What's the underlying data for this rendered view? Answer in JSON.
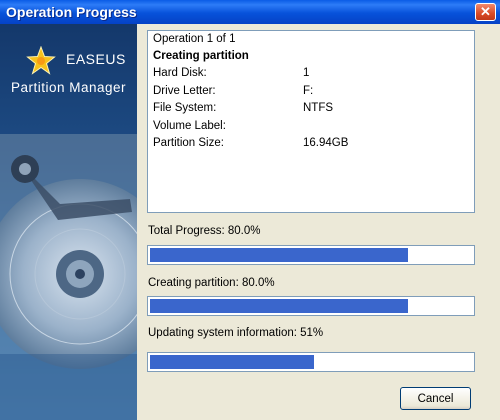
{
  "window": {
    "title": "Operation Progress",
    "close_glyph": "✕"
  },
  "sidebar": {
    "brand": "EASEUS",
    "product": "Partition Manager"
  },
  "info": {
    "operation": "Operation 1 of 1",
    "heading": "Creating partition",
    "rows": [
      {
        "label": "Hard Disk:",
        "value": "1"
      },
      {
        "label": "Drive Letter:",
        "value": "F:"
      },
      {
        "label": "File System:",
        "value": "NTFS"
      },
      {
        "label": "Volume Label:",
        "value": ""
      },
      {
        "label": "Partition Size:",
        "value": "16.94GB"
      }
    ]
  },
  "progress": [
    {
      "label": "Total Progress: 80.0%",
      "percent": 80
    },
    {
      "label": "Creating partition: 80.0%",
      "percent": 80
    },
    {
      "label": "Updating system information: 51%",
      "percent": 51
    }
  ],
  "buttons": {
    "cancel": "Cancel"
  },
  "colors": {
    "titlebar": "#0752da",
    "progress_fill": "#3a66cc",
    "window_bg": "#ece9d8",
    "sidebar": "#1e4d86"
  }
}
